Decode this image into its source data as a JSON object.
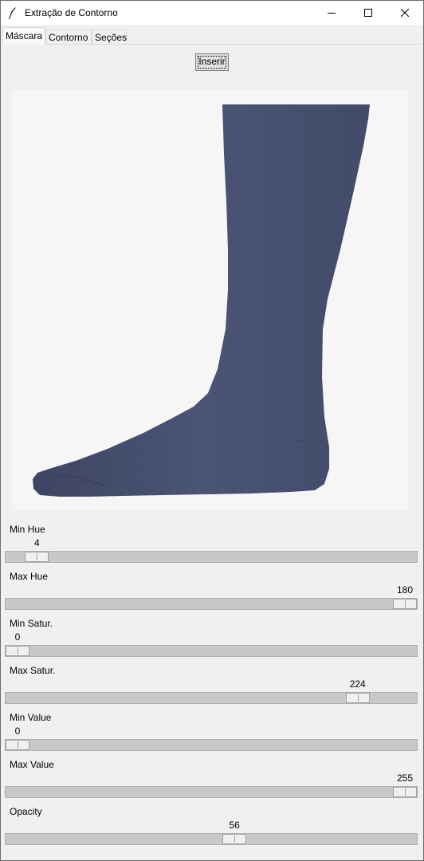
{
  "window": {
    "title": "Extração de Contorno",
    "controls": {
      "minimize": "minimize-icon",
      "maximize": "maximize-icon",
      "close": "close-icon"
    }
  },
  "tabs": [
    {
      "label": "Máscara",
      "active": true
    },
    {
      "label": "Contorno",
      "active": false
    },
    {
      "label": "Seções",
      "active": false
    }
  ],
  "insert_button": {
    "label": "Inserir"
  },
  "image": {
    "subject": "foot-mask-preview",
    "mask_color": "#4a5270"
  },
  "sliders": [
    {
      "label": "Min Hue",
      "value": "4",
      "position": 0.05
    },
    {
      "label": "Max Hue",
      "value": "180",
      "position": 1.0
    },
    {
      "label": "Min Satur.",
      "value": "0",
      "position": 0.0
    },
    {
      "label": "Max Satur.",
      "value": "224",
      "position": 0.878
    },
    {
      "label": "Min Value",
      "value": "0",
      "position": 0.0
    },
    {
      "label": "Max Value",
      "value": "255",
      "position": 1.0
    },
    {
      "label": "Opacity",
      "value": "56",
      "position": 0.56
    }
  ]
}
